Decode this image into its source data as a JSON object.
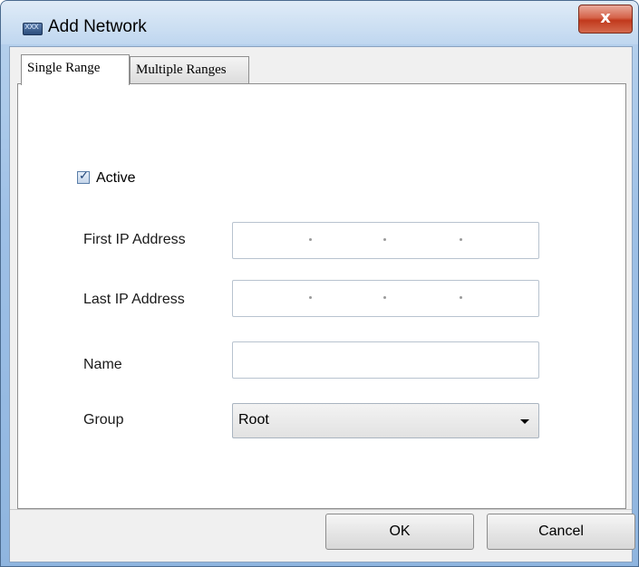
{
  "window": {
    "title": "Add Network",
    "close_glyph": "x",
    "app_icon": "network-app-icon"
  },
  "tabs": [
    {
      "label": "Single Range",
      "active": true
    },
    {
      "label": "Multiple Ranges",
      "active": false
    }
  ],
  "form": {
    "active": {
      "label": "Active",
      "checked": true
    },
    "first_ip": {
      "label": "First IP Address",
      "value": ""
    },
    "last_ip": {
      "label": "Last IP Address",
      "value": ""
    },
    "name": {
      "label": "Name",
      "value": ""
    },
    "group": {
      "label": "Group",
      "selected": "Root"
    }
  },
  "buttons": {
    "ok": "OK",
    "cancel": "Cancel"
  },
  "colors": {
    "frame": "#9ec0e6",
    "close_button": "#c1391c"
  }
}
